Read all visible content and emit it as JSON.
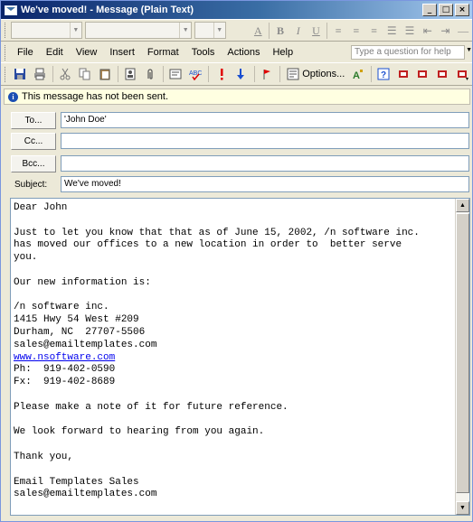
{
  "window": {
    "title": "We've moved! - Message (Plain Text)",
    "controls": {
      "minimize": "_",
      "maximize": "□",
      "close": "×"
    }
  },
  "format_toolbar": {
    "buttons": [
      "A",
      "B",
      "I",
      "U",
      "≡",
      "≡",
      "≡",
      "☰",
      "☰",
      "⇤",
      "⇥",
      "—"
    ]
  },
  "menu": {
    "items": [
      "File",
      "Edit",
      "View",
      "Insert",
      "Format",
      "Tools",
      "Actions",
      "Help"
    ],
    "help_placeholder": "Type a question for help"
  },
  "standard_toolbar": {
    "options_label": "Options..."
  },
  "info_bar": {
    "text": "This message has not been sent."
  },
  "address": {
    "to_label": "To...",
    "to_value": "'John Doe'",
    "cc_label": "Cc...",
    "cc_value": "",
    "bcc_label": "Bcc...",
    "bcc_value": "",
    "subject_label": "Subject:",
    "subject_value": "We've moved!"
  },
  "message": {
    "lines_before_link": "Dear John\n\nJust to let you know that that as of June 15, 2002, /n software inc.\nhas moved our offices to a new location in order to  better serve\nyou.\n\nOur new information is:\n\n/n software inc.\n1415 Hwy 54 West #209\nDurham, NC  27707-5506\nsales@emailtemplates.com",
    "link": "www.nsoftware.com",
    "lines_after_link": "Ph:  919-402-0590\nFx:  919-402-8689\n\nPlease make a note of it for future reference.\n\nWe look forward to hearing from you again.\n\nThank you,\n\nEmail Templates Sales\nsales@emailtemplates.com"
  },
  "colors": {
    "titlebar_start": "#0a246a",
    "titlebar_end": "#a6caf0",
    "info_bg": "#ffffe1",
    "flag_red": "#e00000",
    "arrow_blue": "#1a4fd0"
  }
}
